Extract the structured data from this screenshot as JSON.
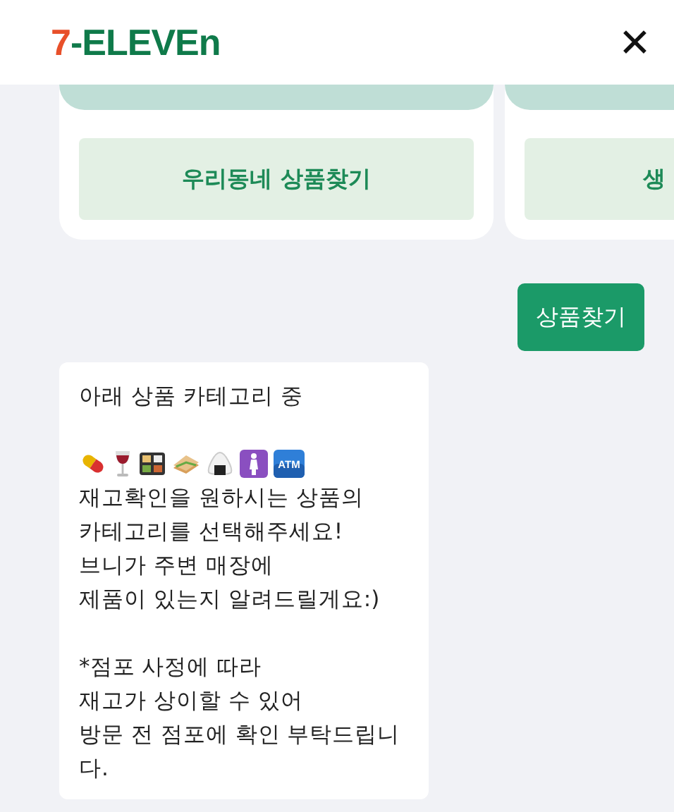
{
  "header": {
    "logo": {
      "seven": "7",
      "brand": "-ELEVEn"
    },
    "close": "✕"
  },
  "cards": [
    {
      "button": "우리동네 상품찾기"
    },
    {
      "button": "생"
    }
  ],
  "user_message": "상품찾기",
  "bot_message": {
    "intro": "아래 상품 카테고리 중",
    "icons": [
      {
        "kind": "pill"
      },
      {
        "kind": "wine"
      },
      {
        "kind": "bento"
      },
      {
        "kind": "sandwich"
      },
      {
        "kind": "riceball"
      },
      {
        "kind": "woman"
      },
      {
        "kind": "atm",
        "label": "ATM"
      }
    ],
    "body": "재고확인을 원하시는 상품의\n카테고리를 선택해주세요!\n브니가 주변 매장에\n제품이 있는지 알려드릴게요:)",
    "notice": "*점포 사정에 따라\n재고가 상이할 수 있어\n방문 전 점포에 확인 부탁드립니다."
  }
}
